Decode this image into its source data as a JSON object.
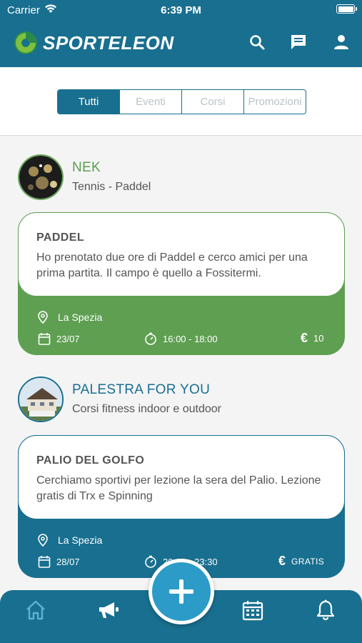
{
  "status_bar": {
    "carrier": "Carrier",
    "time": "6:39 PM",
    "battery_level": 1.0
  },
  "header": {
    "brand": "SPORTELEON",
    "icons": [
      "search-icon",
      "chat-icon",
      "user-icon"
    ]
  },
  "filters": {
    "tabs": [
      "Tutti",
      "Eventi",
      "Corsi",
      "Promozioni"
    ],
    "active": "Tutti"
  },
  "posts": [
    {
      "author": "NEK",
      "subtitle": "Tennis - Paddel",
      "title": "PADDEL",
      "description": "Ho prenotato due ore di Paddel e cerco amici per una prima partita. Il campo è quello a Fossitermi.",
      "location": "La Spezia",
      "date": "23/07",
      "time": "16:00 - 18:00",
      "price": "10",
      "color": "#5f9f52"
    },
    {
      "author": "PALESTRA  FOR YOU",
      "subtitle": "Corsi fitness indoor e outdoor",
      "title": "PALIO DEL GOLFO",
      "description": "Cerchiamo sportivi per lezione la sera del Palio. Lezione gratis di Trx e Spinning",
      "location": "La Spezia",
      "date": "28/07",
      "time": "20:30 - 23:30",
      "price": "GRATIS",
      "color": "#196f8f"
    }
  ],
  "colors": {
    "primary": "#196f8f",
    "accent": "#2c9bc7",
    "event_green": "#5f9f52",
    "text_green": "#5a9e4e"
  },
  "bottom_nav": {
    "items": [
      "home-icon",
      "megaphone-icon",
      "calendar-icon",
      "bell-icon"
    ],
    "fab": "add-icon"
  }
}
